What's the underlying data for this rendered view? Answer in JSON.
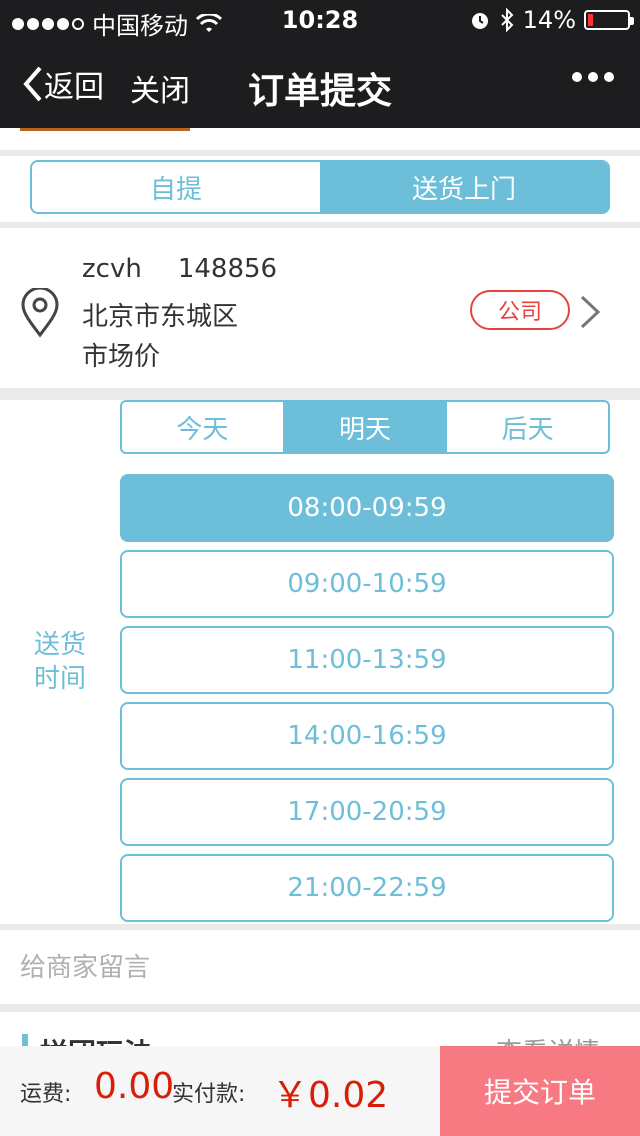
{
  "status_bar": {
    "carrier": "中国移动",
    "time": "10:28",
    "battery": "14%",
    "battery_level": 0.14
  },
  "nav": {
    "back_label": "返回",
    "close_label": "关闭",
    "title": "订单提交"
  },
  "delivery_tabs": [
    {
      "label": "自提",
      "active": false
    },
    {
      "label": "送货上门",
      "active": true
    }
  ],
  "address": {
    "name": "zcvh",
    "phone": "148856",
    "line1": "北京市东城区",
    "line2": "市场价",
    "tag": "公司"
  },
  "delivery_time": {
    "label": "送货时间",
    "days": [
      {
        "label": "今天",
        "active": false
      },
      {
        "label": "明天",
        "active": true
      },
      {
        "label": "后天",
        "active": false
      }
    ],
    "slots": [
      {
        "label": "08:00-09:59",
        "active": true
      },
      {
        "label": "09:00-10:59",
        "active": false
      },
      {
        "label": "11:00-13:59",
        "active": false
      },
      {
        "label": "14:00-16:59",
        "active": false
      },
      {
        "label": "17:00-20:59",
        "active": false
      },
      {
        "label": "21:00-22:59",
        "active": false
      }
    ]
  },
  "message": {
    "placeholder": "给商家留言"
  },
  "group_buy": {
    "title": "拼团玩法",
    "detail": "查看详情"
  },
  "footer": {
    "shipping_label": "运费:",
    "shipping_value": "0.00",
    "payable_label": "实付款:",
    "payable_value": "￥0.02",
    "submit_label": "提交订单"
  },
  "colors": {
    "accent": "#6dbfd9",
    "price": "#d81e06",
    "submit": "#f77a83",
    "tag": "#e64340",
    "bar_bg": "#1d1d1f"
  }
}
